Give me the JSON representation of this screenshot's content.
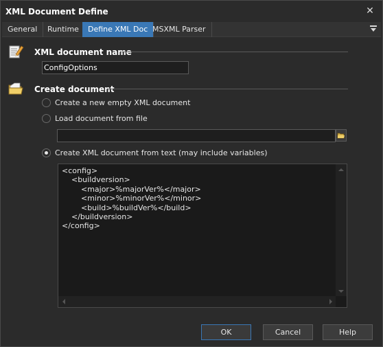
{
  "window": {
    "title": "XML Document Define",
    "close_glyph": "✕"
  },
  "tabs": [
    {
      "label": "General",
      "active": false
    },
    {
      "label": "Runtime",
      "active": false
    },
    {
      "label": "Define XML Doc",
      "active": true
    },
    {
      "label": "MSXML Parser",
      "active": false
    }
  ],
  "xml_name_section": {
    "label": "XML document name",
    "icon": "edit-document-icon",
    "input_value": "ConfigOptions"
  },
  "create_section": {
    "label": "Create document",
    "icon": "folder-icon",
    "options": [
      {
        "label": "Create a new empty XML document",
        "checked": false
      },
      {
        "label": "Load document from file",
        "checked": false
      },
      {
        "label": "Create XML document from text (may include variables)",
        "checked": true
      }
    ],
    "file_path": "",
    "xml_text_lines": [
      "<config>",
      "    <buildversion>",
      "        <major>%majorVer%</major>",
      "        <minor>%minorVer%</minor>",
      "        <build>%buildVer%</build>",
      "    </buildversion>",
      "</config>"
    ]
  },
  "buttons": {
    "ok": "OK",
    "cancel": "Cancel",
    "help": "Help"
  },
  "colors": {
    "background": "#2b2b2b",
    "accent": "#3a78b6"
  }
}
